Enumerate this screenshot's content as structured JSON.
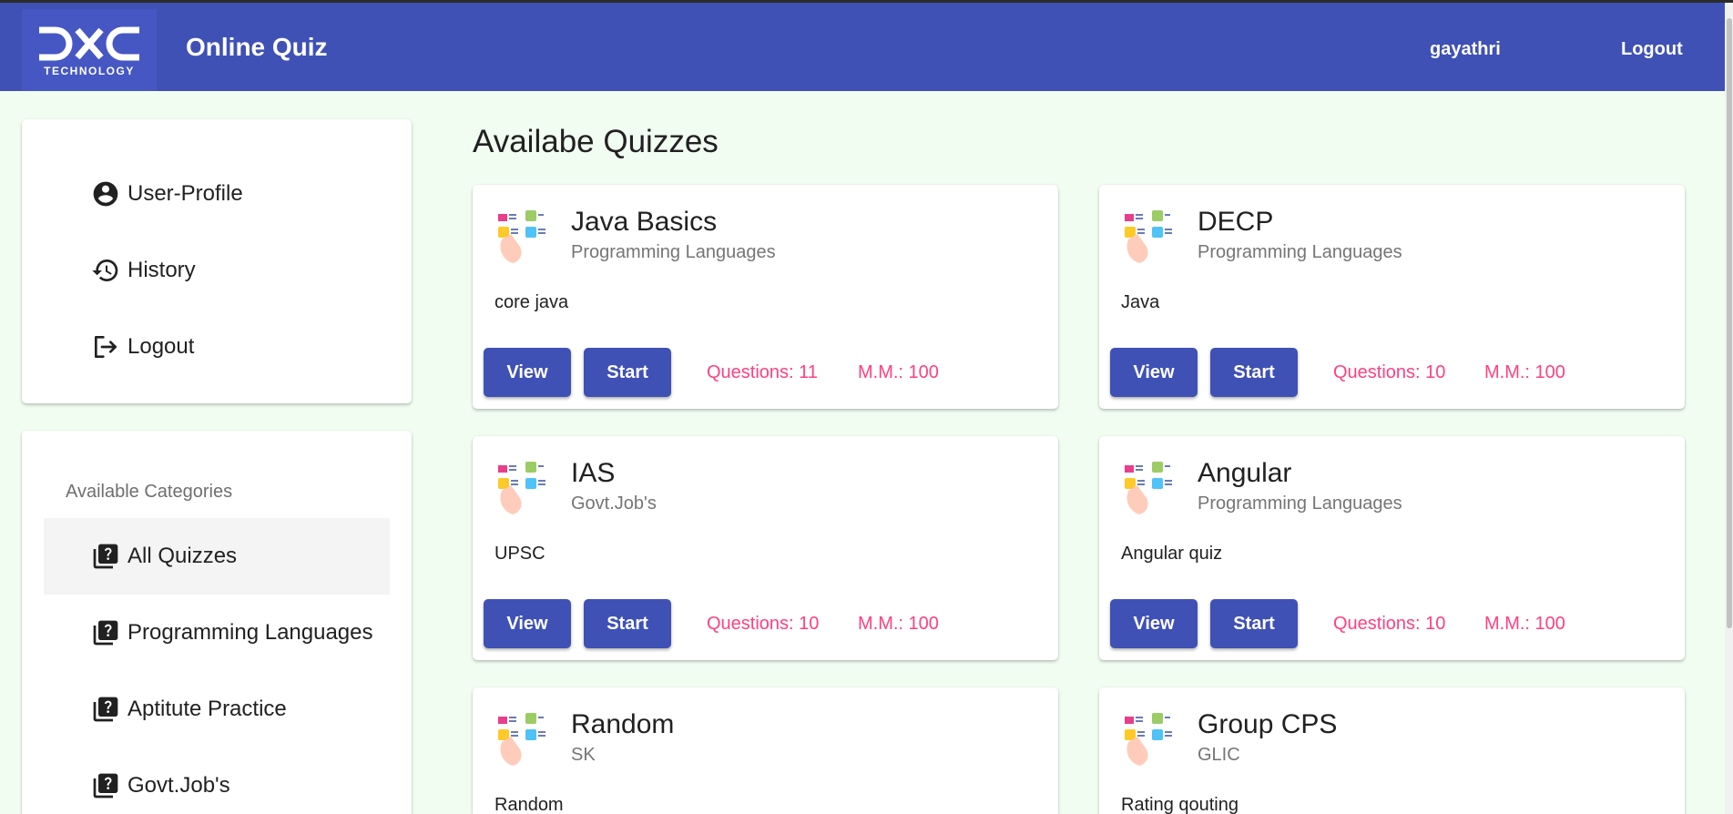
{
  "header": {
    "logo_sub": "TECHNOLOGY",
    "app_title": "Online Quiz",
    "username": "gayathri",
    "logout_label": "Logout",
    "bar_color": "#3f51b5"
  },
  "sidebar": {
    "items": [
      {
        "label": "User-Profile",
        "icon": "account-circle-icon"
      },
      {
        "label": "History",
        "icon": "history-icon"
      },
      {
        "label": "Logout",
        "icon": "logout-icon"
      }
    ],
    "categories_header": "Available Categories",
    "categories": [
      {
        "label": "All Quizzes",
        "icon": "quiz-icon",
        "active": true
      },
      {
        "label": "Programming Languages",
        "icon": "quiz-icon"
      },
      {
        "label": "Aptitute Practice",
        "icon": "quiz-icon"
      },
      {
        "label": "Govt.Job's",
        "icon": "quiz-icon"
      }
    ]
  },
  "main": {
    "heading": "Availabe Quizzes",
    "view_label": "View",
    "start_label": "Start",
    "accent_color": "#ff4081",
    "quizzes": [
      {
        "title": "Java Basics",
        "category": "Programming Languages",
        "description": "core java",
        "questions": "Questions: 11",
        "marks": "M.M.: 100"
      },
      {
        "title": "DECP",
        "category": "Programming Languages",
        "description": "Java",
        "questions": "Questions: 10",
        "marks": "M.M.: 100"
      },
      {
        "title": "IAS",
        "category": "Govt.Job's",
        "description": "UPSC",
        "questions": "Questions: 10",
        "marks": "M.M.: 100"
      },
      {
        "title": "Angular",
        "category": "Programming Languages",
        "description": "Angular quiz",
        "questions": "Questions: 10",
        "marks": "M.M.: 100"
      },
      {
        "title": "Random",
        "category": "SK",
        "description": "Random",
        "questions": "",
        "marks": ""
      },
      {
        "title": "Group CPS",
        "category": "GLIC",
        "description": "Rating qouting",
        "questions": "",
        "marks": ""
      }
    ]
  }
}
